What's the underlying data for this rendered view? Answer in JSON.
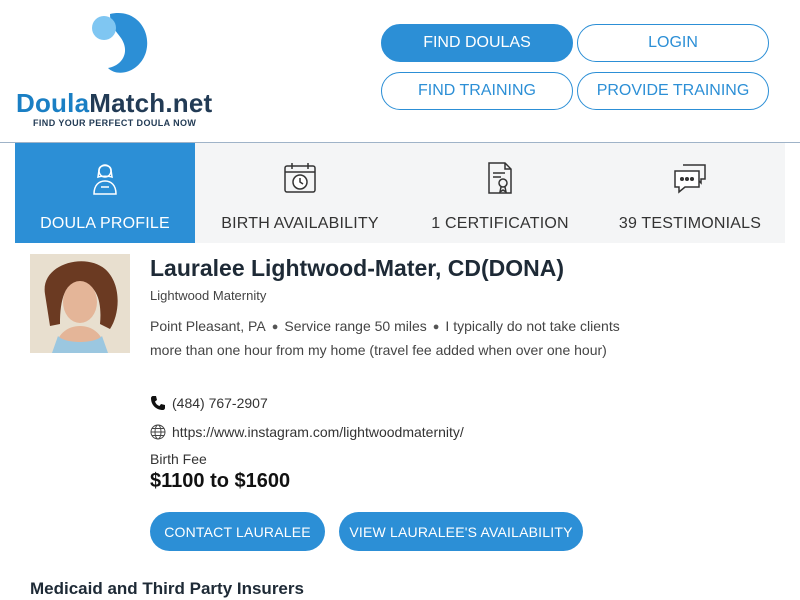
{
  "brand": {
    "name_part1": "Doula",
    "name_part2": "Match.net",
    "tagline": "FIND YOUR PERFECT DOULA NOW",
    "primary_color": "#2c8fd6"
  },
  "header_nav": {
    "find_doulas": "FIND DOULAS",
    "login": "LOGIN",
    "find_training": "FIND TRAINING",
    "provide_training": "PROVIDE TRAINING"
  },
  "tabs": [
    {
      "label": "DOULA PROFILE",
      "icon": "doula-person-icon",
      "active": true
    },
    {
      "label": "BIRTH AVAILABILITY",
      "icon": "calendar-clock-icon",
      "active": false
    },
    {
      "label": "1 CERTIFICATION",
      "icon": "certificate-icon",
      "active": false
    },
    {
      "label": "39 TESTIMONIALS",
      "icon": "chat-bubbles-icon",
      "active": false
    }
  ],
  "profile": {
    "name": "Lauralee Lightwood-Mater, CD(DONA)",
    "company": "Lightwood Maternity",
    "location": "Point Pleasant, PA",
    "service_range": "Service range 50 miles",
    "travel_note": "I typically do not take clients more than one hour from my home (travel fee added when over one hour)",
    "phone": "(484) 767-2907",
    "website": "https://www.instagram.com/lightwoodmaternity/",
    "fee_label": "Birth Fee",
    "fee": "$1100 to $1600",
    "contact_button": "CONTACT LAURALEE",
    "availability_button": "VIEW LAURALEE'S AVAILABILITY"
  },
  "section": {
    "title": "Medicaid and Third Party Insurers"
  }
}
